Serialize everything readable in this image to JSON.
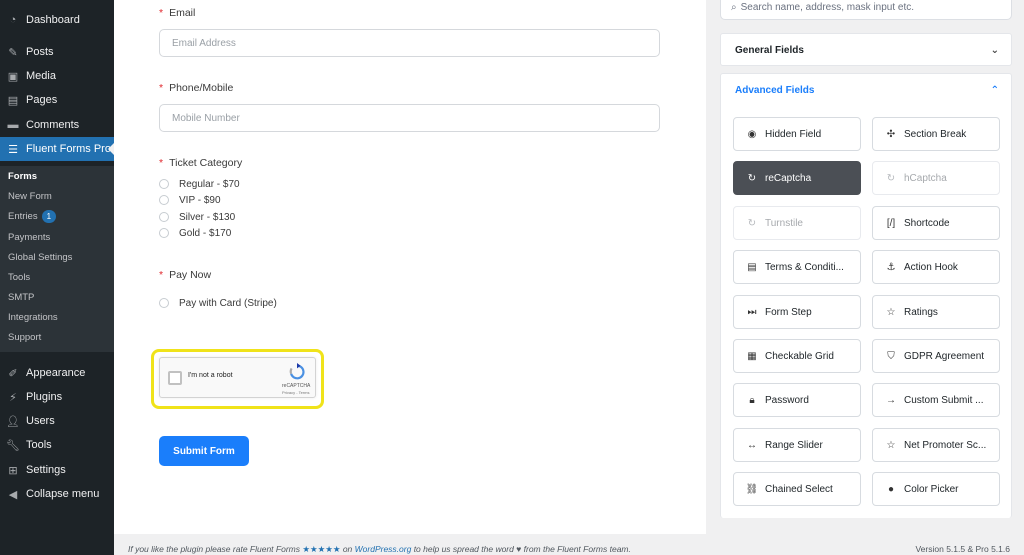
{
  "admin_menu": {
    "items_top": [
      {
        "label": "Dashboard",
        "icon": "dashboard-icon"
      },
      {
        "label": "Posts",
        "icon": "pin-icon"
      },
      {
        "label": "Media",
        "icon": "media-icon"
      },
      {
        "label": "Pages",
        "icon": "pages-icon"
      },
      {
        "label": "Comments",
        "icon": "comments-icon"
      },
      {
        "label": "Fluent Forms Pro",
        "icon": "forms-icon"
      }
    ],
    "submenu": [
      {
        "label": "Forms"
      },
      {
        "label": "New Form"
      },
      {
        "label": "Entries",
        "badge": "1"
      },
      {
        "label": "Payments"
      },
      {
        "label": "Global Settings"
      },
      {
        "label": "Tools"
      },
      {
        "label": "SMTP"
      },
      {
        "label": "Integrations"
      },
      {
        "label": "Support"
      }
    ],
    "items_bottom": [
      {
        "label": "Appearance",
        "icon": "brush-icon"
      },
      {
        "label": "Plugins",
        "icon": "plugin-icon"
      },
      {
        "label": "Users",
        "icon": "users-icon"
      },
      {
        "label": "Tools",
        "icon": "wrench-icon"
      },
      {
        "label": "Settings",
        "icon": "settings-icon"
      },
      {
        "label": "Collapse menu",
        "icon": "collapse-icon"
      }
    ]
  },
  "form": {
    "email": {
      "label": "Email",
      "placeholder": "Email Address"
    },
    "phone": {
      "label": "Phone/Mobile",
      "placeholder": "Mobile Number"
    },
    "ticket": {
      "label": "Ticket Category",
      "options": [
        "Regular - $70",
        "VIP - $90",
        "Silver - $130",
        "Gold - $170"
      ]
    },
    "pay": {
      "label": "Pay Now",
      "options": [
        "Pay with Card (Stripe)"
      ]
    },
    "captcha": {
      "text": "I'm not a robot",
      "brand": "reCAPTCHA",
      "terms": "Privacy - Terms"
    },
    "submit_label": "Submit Form"
  },
  "panel": {
    "search_placeholder": "Search name, address, mask input etc.",
    "general_title": "General Fields",
    "advanced_title": "Advanced Fields",
    "fields": [
      {
        "label": "Hidden Field",
        "icon": "eye-slash-icon",
        "glyph": "◉",
        "state": "normal"
      },
      {
        "label": "Section Break",
        "icon": "puzzle-icon",
        "glyph": "✣",
        "state": "normal"
      },
      {
        "label": "reCaptcha",
        "icon": "recaptcha-icon",
        "glyph": "↻",
        "state": "active"
      },
      {
        "label": "hCaptcha",
        "icon": "hcaptcha-icon",
        "glyph": "↻",
        "state": "disabled"
      },
      {
        "label": "Turnstile",
        "icon": "turnstile-icon",
        "glyph": "↻",
        "state": "disabled"
      },
      {
        "label": "Shortcode",
        "icon": "shortcode-icon",
        "glyph": "[/]",
        "state": "normal"
      },
      {
        "label": "Terms & Conditi...",
        "icon": "document-icon",
        "glyph": "▤",
        "state": "normal"
      },
      {
        "label": "Action Hook",
        "icon": "hook-icon",
        "glyph": "⚓",
        "state": "normal"
      },
      {
        "label": "Form Step",
        "icon": "step-icon",
        "glyph": "⏭",
        "state": "normal"
      },
      {
        "label": "Ratings",
        "icon": "star-icon",
        "glyph": "☆",
        "state": "normal"
      },
      {
        "label": "Checkable Grid",
        "icon": "grid-icon",
        "glyph": "▦",
        "state": "normal"
      },
      {
        "label": "GDPR Agreement",
        "icon": "shield-icon",
        "glyph": "⛉",
        "state": "normal"
      },
      {
        "label": "Password",
        "icon": "lock-icon",
        "glyph": "🔒︎",
        "state": "normal"
      },
      {
        "label": "Custom Submit ...",
        "icon": "arrow-right-icon",
        "glyph": "→",
        "state": "normal"
      },
      {
        "label": "Range Slider",
        "icon": "slider-icon",
        "glyph": "↔",
        "state": "normal"
      },
      {
        "label": "Net Promoter Sc...",
        "icon": "star-icon",
        "glyph": "☆",
        "state": "normal"
      },
      {
        "label": "Chained Select",
        "icon": "link-icon",
        "glyph": "⛓",
        "state": "normal"
      },
      {
        "label": "Color Picker",
        "icon": "droplet-icon",
        "glyph": "●",
        "state": "normal"
      }
    ]
  },
  "footer": {
    "text_before": "If you like the plugin please rate Fluent Forms ",
    "stars": "★★★★★",
    "text_on": " on ",
    "link": "WordPress.org",
    "text_after": " to help us spread the word ♥ from the Fluent Forms team.",
    "version": "Version 5.1.5 & Pro 5.1.6"
  },
  "colors": {
    "accent": "#1a7efb",
    "admin_bg": "#1d2327",
    "admin_active": "#2271b1",
    "highlight": "#f0e31a"
  }
}
